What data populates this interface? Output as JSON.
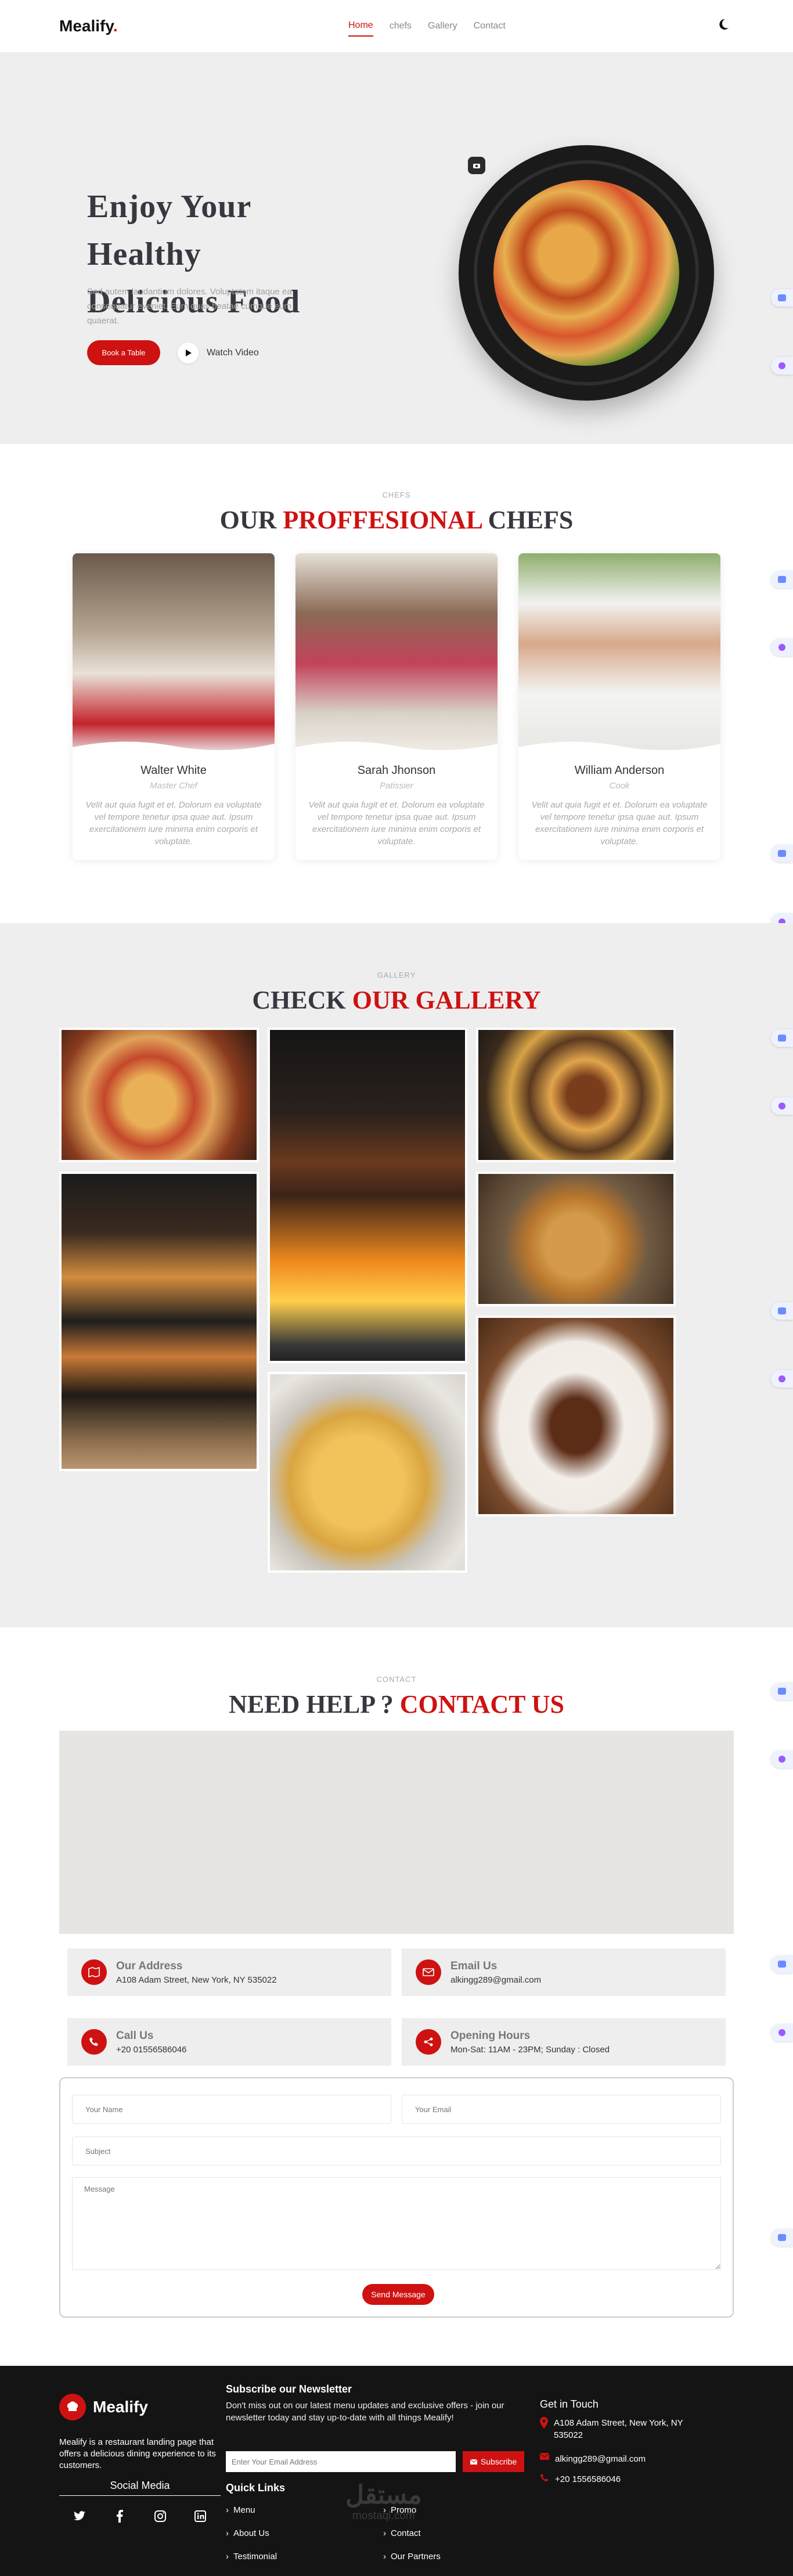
{
  "nav": {
    "logo": "Mealify",
    "logo_dot": ".",
    "items": [
      "Home",
      "chefs",
      "Gallery",
      "Contact"
    ]
  },
  "hero": {
    "title_line1": "Enjoy Your Healthy",
    "title_line2": "Delicious Food",
    "description": "Sed autem laudantium dolores. Voluptatem itaque ea consequatur eveniet. Eum quas beatae cumque eum quaerat.",
    "book_label": "Book a Table",
    "watch_label": "Watch Video"
  },
  "chefs": {
    "subtitle": "CHEFS",
    "title_a": "OUR",
    "title_b": "PROFFESIONAL",
    "title_c": "CHEFS",
    "items": [
      {
        "name": "Walter White",
        "role": "Master Chef",
        "desc": "Velit aut quia fugit et et. Dolorum ea voluptate vel tempore tenetur ipsa quae aut. Ipsum exercitationem iure minima enim corporis et voluptate."
      },
      {
        "name": "Sarah Jhonson",
        "role": "Patissier",
        "desc": "Velit aut quia fugit et et. Dolorum ea voluptate vel tempore tenetur ipsa quae aut. Ipsum exercitationem iure minima enim corporis et voluptate."
      },
      {
        "name": "William Anderson",
        "role": "Cook",
        "desc": "Velit aut quia fugit et et. Dolorum ea voluptate vel tempore tenetur ipsa quae aut. Ipsum exercitationem iure minima enim corporis et voluptate."
      }
    ]
  },
  "gallery": {
    "subtitle": "GALLERY",
    "title_a": "CHECK",
    "title_b": "OUR GALLERY"
  },
  "contact": {
    "subtitle": "CONTACT",
    "title_a": "NEED HELP ?",
    "title_b": "CONTACT US",
    "address_h": "Our Address",
    "address_v": "A108 Adam Street, New York, NY 535022",
    "email_h": "Email Us",
    "email_v": "alkingg289@gmail.com",
    "call_h": "Call Us",
    "call_v": "+20 01556586046",
    "hours_h": "Opening Hours",
    "hours_v": "Mon-Sat: 11AM - 23PM; Sunday : Closed",
    "ph_name": "Your Name",
    "ph_email": "Your Email",
    "ph_subject": "Subject",
    "ph_message": "Message",
    "send_label": "Send Message"
  },
  "footer": {
    "brand": "Mealify",
    "about": "Mealify is a restaurant landing page that offers a delicious dining experience to its customers.",
    "social_title": "Social Media",
    "news_title": "Subscribe our Newsletter",
    "news_text": "Don't miss out on our latest menu updates and exclusive offers - join our newsletter today and stay up-to-date with all things Mealify!",
    "email_placeholder": "Enter Your Email Address",
    "subscribe_label": "Subscribe",
    "quick_title": "Quick Links",
    "links_col1": [
      "Menu",
      "About Us",
      "Testimonial"
    ],
    "links_col2": [
      "Promo",
      "Contact",
      "Our Partners"
    ],
    "touch_title": "Get in Touch",
    "touch_address": "A108 Adam Street, New York, NY 535022",
    "touch_email": "alkingg289@gmail.com",
    "touch_phone": "+20 1556586046",
    "watermark_ar": "مستقل",
    "watermark_en": "mostaql.com"
  },
  "colors": {
    "accent": "#ce1212",
    "dark": "#37373f",
    "light_bg": "#eeeeee",
    "footer_bg": "#141414"
  }
}
